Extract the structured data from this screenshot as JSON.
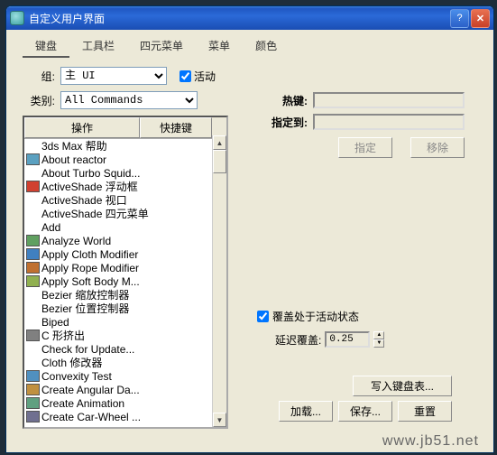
{
  "window": {
    "title": "自定义用户界面"
  },
  "tabs": [
    "键盘",
    "工具栏",
    "四元菜单",
    "菜单",
    "颜色"
  ],
  "active_tab": 0,
  "group": {
    "label": "组:",
    "value": "主 UI",
    "active_label": "活动"
  },
  "category": {
    "label": "类别:",
    "value": "All Commands"
  },
  "list": {
    "header_action": "操作",
    "header_shortcut": "快捷键",
    "items": [
      {
        "icon": "",
        "text": "3ds Max 帮助"
      },
      {
        "icon": "q",
        "text": "About reactor"
      },
      {
        "icon": "",
        "text": "About Turbo Squid..."
      },
      {
        "icon": "a",
        "text": "ActiveShade 浮动框"
      },
      {
        "icon": "",
        "text": "ActiveShade 视口"
      },
      {
        "icon": "",
        "text": "ActiveShade 四元菜单"
      },
      {
        "icon": "",
        "text": "Add"
      },
      {
        "icon": "g",
        "text": "Analyze World"
      },
      {
        "icon": "c",
        "text": "Apply Cloth Modifier"
      },
      {
        "icon": "r",
        "text": "Apply Rope Modifier"
      },
      {
        "icon": "s",
        "text": "Apply Soft Body M..."
      },
      {
        "icon": "",
        "text": "Bezier 缩放控制器"
      },
      {
        "icon": "",
        "text": "Bezier 位置控制器"
      },
      {
        "icon": "",
        "text": "Biped"
      },
      {
        "icon": "e",
        "text": "C 形挤出"
      },
      {
        "icon": "",
        "text": "Check for Update..."
      },
      {
        "icon": "",
        "text": "Cloth 修改器"
      },
      {
        "icon": "v",
        "text": "Convexity Test"
      },
      {
        "icon": "d",
        "text": "Create Angular Da..."
      },
      {
        "icon": "n",
        "text": "Create Animation"
      },
      {
        "icon": "w",
        "text": "Create Car-Wheel ..."
      }
    ]
  },
  "hotkey": {
    "label": "热键:"
  },
  "assigned": {
    "label": "指定到:"
  },
  "assign_btn": "指定",
  "remove_btn": "移除",
  "overwrite": {
    "label": "覆盖处于活动状态",
    "delay_label": "延迟覆盖:",
    "delay_value": "0.25"
  },
  "write_btn": "写入键盘表...",
  "load_btn": "加载...",
  "save_btn": "保存...",
  "reset_btn": "重置",
  "watermark": "www.jb51.net"
}
